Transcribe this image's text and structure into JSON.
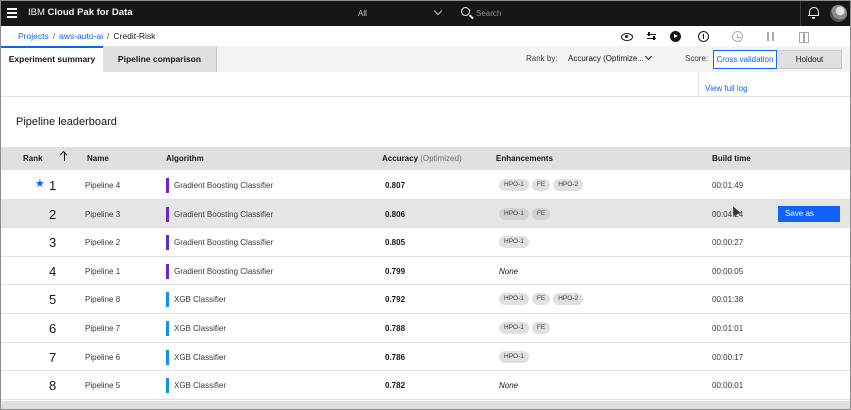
{
  "topbar": {
    "brand_prefix": "IBM",
    "brand_name": "Cloud Pak for Data",
    "scope": "All",
    "search_placeholder": "Search"
  },
  "breadcrumb": {
    "projects": "Projects",
    "project": "aws-auto-ai",
    "current": "Credit-Risk"
  },
  "tabs": {
    "summary": "Experiment summary",
    "comparison": "Pipeline comparison"
  },
  "controls": {
    "rank_by_label": "Rank by:",
    "rank_by_value": "Accuracy (Optimize...",
    "score_label": "Score:",
    "score_options": [
      "Cross validation",
      "Holdout"
    ],
    "score_selected": "Cross validation"
  },
  "log_link": "View full log",
  "leaderboard": {
    "title": "Pipeline leaderboard",
    "columns": {
      "rank": "Rank",
      "name": "Name",
      "algorithm": "Algorithm",
      "accuracy": "Accuracy",
      "accuracy_note": "(Optimized)",
      "enhancements": "Enhancements",
      "build_time": "Build time"
    },
    "save_as_label": "Save as",
    "rows": [
      {
        "rank": "1",
        "starred": true,
        "name": "Pipeline 4",
        "algorithm": "Gradient Boosting Classifier",
        "algo_color": "#6929c4",
        "accuracy": "0.807",
        "enhancements": [
          "HPO-1",
          "FE",
          "HPO-2"
        ],
        "build_time": "00:01:49"
      },
      {
        "rank": "2",
        "starred": false,
        "name": "Pipeline 3",
        "algorithm": "Gradient Boosting Classifier",
        "algo_color": "#6929c4",
        "accuracy": "0.806",
        "enhancements": [
          "HPO-1",
          "FE"
        ],
        "build_time": "00:04:24",
        "highlighted": true
      },
      {
        "rank": "3",
        "starred": false,
        "name": "Pipeline 2",
        "algorithm": "Gradient Boosting Classifier",
        "algo_color": "#6929c4",
        "accuracy": "0.805",
        "enhancements": [
          "HPO-1"
        ],
        "build_time": "00:00:27"
      },
      {
        "rank": "4",
        "starred": false,
        "name": "Pipeline 1",
        "algorithm": "Gradient Boosting Classifier",
        "algo_color": "#6929c4",
        "accuracy": "0.799",
        "enhancements": [],
        "none_label": "None",
        "build_time": "00:00:05"
      },
      {
        "rank": "5",
        "starred": false,
        "name": "Pipeline 8",
        "algorithm": "XGB Classifier",
        "algo_color": "#1192e8",
        "accuracy": "0.792",
        "enhancements": [
          "HPO-1",
          "FE",
          "HPO-2"
        ],
        "build_time": "00:01:38"
      },
      {
        "rank": "6",
        "starred": false,
        "name": "Pipeline 7",
        "algorithm": "XGB Classifier",
        "algo_color": "#1192e8",
        "accuracy": "0.788",
        "enhancements": [
          "HPO-1",
          "FE"
        ],
        "build_time": "00:01:01"
      },
      {
        "rank": "7",
        "starred": false,
        "name": "Pipeline 6",
        "algorithm": "XGB Classifier",
        "algo_color": "#1192e8",
        "accuracy": "0.786",
        "enhancements": [
          "HPO-1"
        ],
        "build_time": "00:00:17"
      },
      {
        "rank": "8",
        "starred": false,
        "name": "Pipeline 5",
        "algorithm": "XGB Classifier",
        "algo_color": "#1192e8",
        "accuracy": "0.782",
        "enhancements": [],
        "none_label": "None",
        "build_time": "00:00:01"
      }
    ]
  },
  "colors": {
    "accent": "#0f62fe",
    "topbar_bg": "#161616",
    "gbc_color": "#6929c4",
    "xgb_color": "#1192e8"
  }
}
